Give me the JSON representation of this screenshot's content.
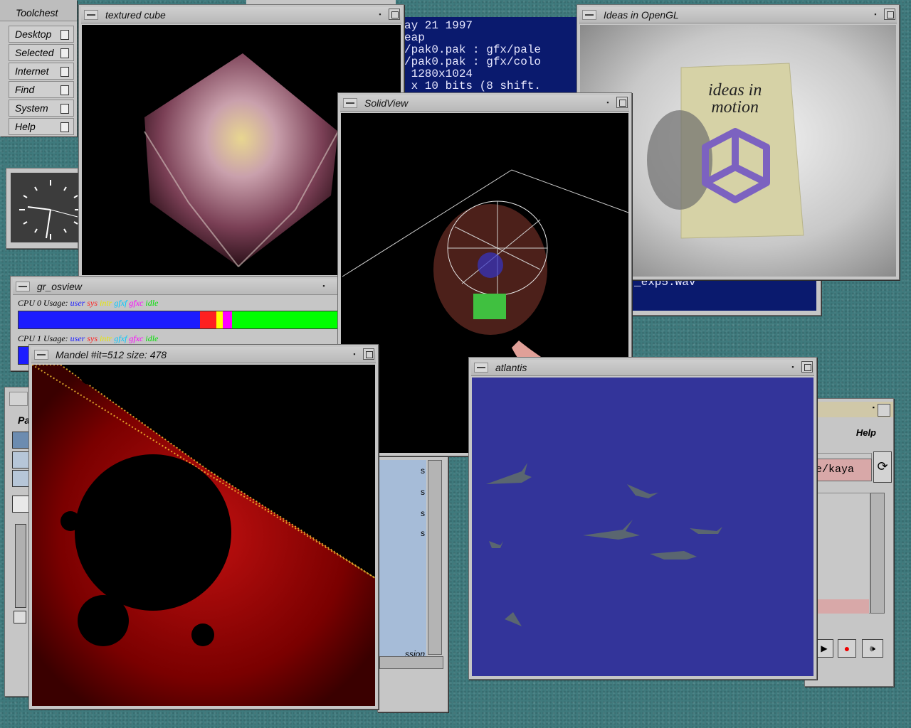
{
  "toolchest": {
    "title": "Toolchest",
    "items": [
      "Desktop",
      "Selected",
      "Internet",
      "Find",
      "System",
      "Help"
    ]
  },
  "windows": {
    "textured_cube": {
      "title": "textured cube"
    },
    "solidview": {
      "title": "SolidView"
    },
    "ideas": {
      "title": "Ideas in OpenGL",
      "poster_text_line1": "ideas in",
      "poster_text_line2": "motion"
    },
    "osview": {
      "title": "gr_osview",
      "cpu0": "CPU 0 Usage:",
      "cpu1": "CPU 1 Usage:",
      "legend": [
        "user",
        "sys",
        "intr",
        "gfxf",
        "gfxc",
        "idle"
      ],
      "colors": {
        "user": "#1c1cff",
        "sys": "#ff2020",
        "intr": "#ffff00",
        "gfxf": "#00c8ff",
        "gfxc": "#ff00ff",
        "idle": "#00ff00"
      }
    },
    "mandel": {
      "title": "Mandel  #it=512  size: 478"
    },
    "atlantis": {
      "title": "atlantis",
      "bg": "#33349a"
    },
    "terminal_top": {
      "lines": [
        "ay 21 1997",
        "eap",
        "/pak0.pak : gfx/pale",
        "/pak0.pak : gfx/colo",
        " 1280x1024",
        " x 10 bits (8 shift."
      ]
    },
    "terminal_mid": {
      "line": "_exp5.wav"
    },
    "soundtool": {
      "help": "Help",
      "path": "e/kaya"
    },
    "filemgr": {
      "session_label": "ssion",
      "items": [
        "s",
        "s",
        "s",
        "s"
      ]
    },
    "partial_left": {
      "label": "Pa"
    }
  }
}
